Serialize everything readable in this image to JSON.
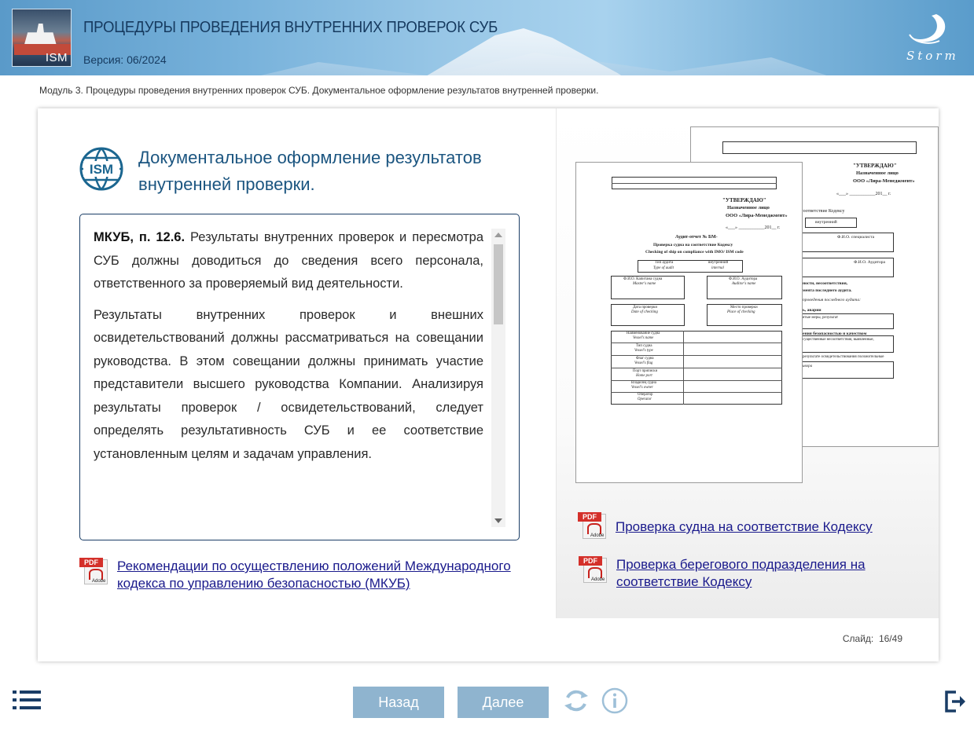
{
  "header": {
    "title": "ПРОЦЕДУРЫ ПРОВЕДЕНИЯ ВНУТРЕННИХ ПРОВЕРОК СУБ",
    "version": "Версия: 06/2024",
    "logo_text": "ISM",
    "brand_text": "Storm"
  },
  "breadcrumb": "Модуль 3. Процедуры проведения внутренних проверок СУБ. Документальное оформление результатов внутренней проверки.",
  "slide": {
    "heading_line1": "Документальное оформление результатов",
    "heading_line2": "внутренней проверки.",
    "icon_text": "ISM",
    "paragraph1_lead": "МКУБ, п. 12.6.",
    "paragraph1_body": " Результаты внутренних проверок и пересмотра СУБ должны доводиться до сведения всего персонала, ответственного за проверяемый вид деятельности.",
    "paragraph2": "Результаты внутренних проверок и внешних освидетельствований должны рассматриваться на совещании руководства. В этом совещании должны принимать участие представители высшего руководства Компании. Анализируя результаты проверок / освидетельствований, следует определять результативность СУБ и ее соответствие установленным целям и задачам управления.",
    "left_link": "Рекомендации по осуществлению положений Международного кодекса по управлению безопасностью (МКУБ)",
    "right_link1": "Проверка судна на соответствие Кодексу",
    "right_link2": "Проверка берегового подразделения на соответствие Кодексу",
    "pdf_label": "PDF",
    "adobe_label": "Adobe"
  },
  "document_preview": {
    "approve": "\"УТВЕРЖДАЮ\"",
    "designated_person": "Назначенное лицо",
    "company": "ООО «Лира-Менеджмент»",
    "date_line": "«___» ___________201__ г.",
    "report_title": "Аудит-отчет № БМ-",
    "report_sub1": "Проверка судна на соответствие Кодексу",
    "report_sub2": "Checking of ship on compliance with IMO/ ISM code",
    "audit_type": "Тип аудита",
    "audit_type_en": "Type of audit",
    "internal": "внутренний",
    "internal_en": "internal",
    "captain": "Ф.И.О. Капитана судна",
    "captain_en": "Master's name",
    "auditor": "Ф.И.О. Аудитора",
    "auditor_en": "Auditor's name",
    "check_date": "Дата проверки",
    "check_date_en": "Date of checking",
    "check_place": "Место проверки",
    "check_place_en": "Place of checking",
    "vessel_name": "Наименование судна",
    "vessel_name_en": "Vessel's name",
    "vessel_type": "Тип судна",
    "vessel_type_en": "Vessel's type",
    "vessel_flag": "Флаг судна",
    "vessel_flag_en": "Vessel's flag",
    "home_port": "Порт приписки",
    "home_port_en": "Home port",
    "owner": "Владелец судна",
    "owner_en": "Vessel's owner",
    "operator": "Оператор",
    "operator_en": "Operator",
    "back_shore_check": "соответствие Кодексу",
    "back_specialist": "Ф.И.О. специалиста",
    "back_audit_prev": "проведения последнего аудита:",
    "back_nonconf": "ности, несоответствия,",
    "back_last_audit": "мента последнего аудита.",
    "back_measures": "ь, аварии",
    "back_results": "ятые меры, результат",
    "back_safety": "ения безопасностью и качеством",
    "back_defects": "существенные несоответствия, выявленные,",
    "back_survey": "результате освидетельствования положительные",
    "back_other": "ивора"
  },
  "footer": {
    "slide_label": "Слайд:",
    "slide_current": "16",
    "slide_total": "49",
    "back_button": "Назад",
    "next_button": "Далее"
  }
}
